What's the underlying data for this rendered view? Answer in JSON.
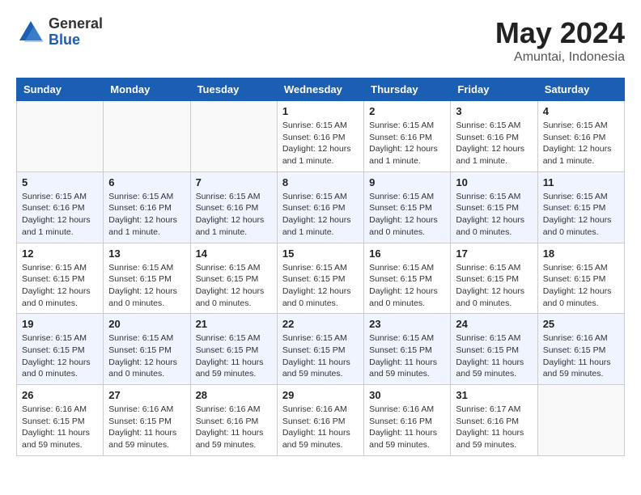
{
  "logo": {
    "general": "General",
    "blue": "Blue"
  },
  "title": "May 2024",
  "location": "Amuntai, Indonesia",
  "days_of_week": [
    "Sunday",
    "Monday",
    "Tuesday",
    "Wednesday",
    "Thursday",
    "Friday",
    "Saturday"
  ],
  "weeks": [
    [
      {
        "day": "",
        "info": ""
      },
      {
        "day": "",
        "info": ""
      },
      {
        "day": "",
        "info": ""
      },
      {
        "day": "1",
        "info": "Sunrise: 6:15 AM\nSunset: 6:16 PM\nDaylight: 12 hours\nand 1 minute."
      },
      {
        "day": "2",
        "info": "Sunrise: 6:15 AM\nSunset: 6:16 PM\nDaylight: 12 hours\nand 1 minute."
      },
      {
        "day": "3",
        "info": "Sunrise: 6:15 AM\nSunset: 6:16 PM\nDaylight: 12 hours\nand 1 minute."
      },
      {
        "day": "4",
        "info": "Sunrise: 6:15 AM\nSunset: 6:16 PM\nDaylight: 12 hours\nand 1 minute."
      }
    ],
    [
      {
        "day": "5",
        "info": "Sunrise: 6:15 AM\nSunset: 6:16 PM\nDaylight: 12 hours\nand 1 minute."
      },
      {
        "day": "6",
        "info": "Sunrise: 6:15 AM\nSunset: 6:16 PM\nDaylight: 12 hours\nand 1 minute."
      },
      {
        "day": "7",
        "info": "Sunrise: 6:15 AM\nSunset: 6:16 PM\nDaylight: 12 hours\nand 1 minute."
      },
      {
        "day": "8",
        "info": "Sunrise: 6:15 AM\nSunset: 6:16 PM\nDaylight: 12 hours\nand 1 minute."
      },
      {
        "day": "9",
        "info": "Sunrise: 6:15 AM\nSunset: 6:15 PM\nDaylight: 12 hours\nand 0 minutes."
      },
      {
        "day": "10",
        "info": "Sunrise: 6:15 AM\nSunset: 6:15 PM\nDaylight: 12 hours\nand 0 minutes."
      },
      {
        "day": "11",
        "info": "Sunrise: 6:15 AM\nSunset: 6:15 PM\nDaylight: 12 hours\nand 0 minutes."
      }
    ],
    [
      {
        "day": "12",
        "info": "Sunrise: 6:15 AM\nSunset: 6:15 PM\nDaylight: 12 hours\nand 0 minutes."
      },
      {
        "day": "13",
        "info": "Sunrise: 6:15 AM\nSunset: 6:15 PM\nDaylight: 12 hours\nand 0 minutes."
      },
      {
        "day": "14",
        "info": "Sunrise: 6:15 AM\nSunset: 6:15 PM\nDaylight: 12 hours\nand 0 minutes."
      },
      {
        "day": "15",
        "info": "Sunrise: 6:15 AM\nSunset: 6:15 PM\nDaylight: 12 hours\nand 0 minutes."
      },
      {
        "day": "16",
        "info": "Sunrise: 6:15 AM\nSunset: 6:15 PM\nDaylight: 12 hours\nand 0 minutes."
      },
      {
        "day": "17",
        "info": "Sunrise: 6:15 AM\nSunset: 6:15 PM\nDaylight: 12 hours\nand 0 minutes."
      },
      {
        "day": "18",
        "info": "Sunrise: 6:15 AM\nSunset: 6:15 PM\nDaylight: 12 hours\nand 0 minutes."
      }
    ],
    [
      {
        "day": "19",
        "info": "Sunrise: 6:15 AM\nSunset: 6:15 PM\nDaylight: 12 hours\nand 0 minutes."
      },
      {
        "day": "20",
        "info": "Sunrise: 6:15 AM\nSunset: 6:15 PM\nDaylight: 12 hours\nand 0 minutes."
      },
      {
        "day": "21",
        "info": "Sunrise: 6:15 AM\nSunset: 6:15 PM\nDaylight: 11 hours\nand 59 minutes."
      },
      {
        "day": "22",
        "info": "Sunrise: 6:15 AM\nSunset: 6:15 PM\nDaylight: 11 hours\nand 59 minutes."
      },
      {
        "day": "23",
        "info": "Sunrise: 6:15 AM\nSunset: 6:15 PM\nDaylight: 11 hours\nand 59 minutes."
      },
      {
        "day": "24",
        "info": "Sunrise: 6:15 AM\nSunset: 6:15 PM\nDaylight: 11 hours\nand 59 minutes."
      },
      {
        "day": "25",
        "info": "Sunrise: 6:16 AM\nSunset: 6:15 PM\nDaylight: 11 hours\nand 59 minutes."
      }
    ],
    [
      {
        "day": "26",
        "info": "Sunrise: 6:16 AM\nSunset: 6:15 PM\nDaylight: 11 hours\nand 59 minutes."
      },
      {
        "day": "27",
        "info": "Sunrise: 6:16 AM\nSunset: 6:15 PM\nDaylight: 11 hours\nand 59 minutes."
      },
      {
        "day": "28",
        "info": "Sunrise: 6:16 AM\nSunset: 6:16 PM\nDaylight: 11 hours\nand 59 minutes."
      },
      {
        "day": "29",
        "info": "Sunrise: 6:16 AM\nSunset: 6:16 PM\nDaylight: 11 hours\nand 59 minutes."
      },
      {
        "day": "30",
        "info": "Sunrise: 6:16 AM\nSunset: 6:16 PM\nDaylight: 11 hours\nand 59 minutes."
      },
      {
        "day": "31",
        "info": "Sunrise: 6:17 AM\nSunset: 6:16 PM\nDaylight: 11 hours\nand 59 minutes."
      },
      {
        "day": "",
        "info": ""
      }
    ]
  ]
}
